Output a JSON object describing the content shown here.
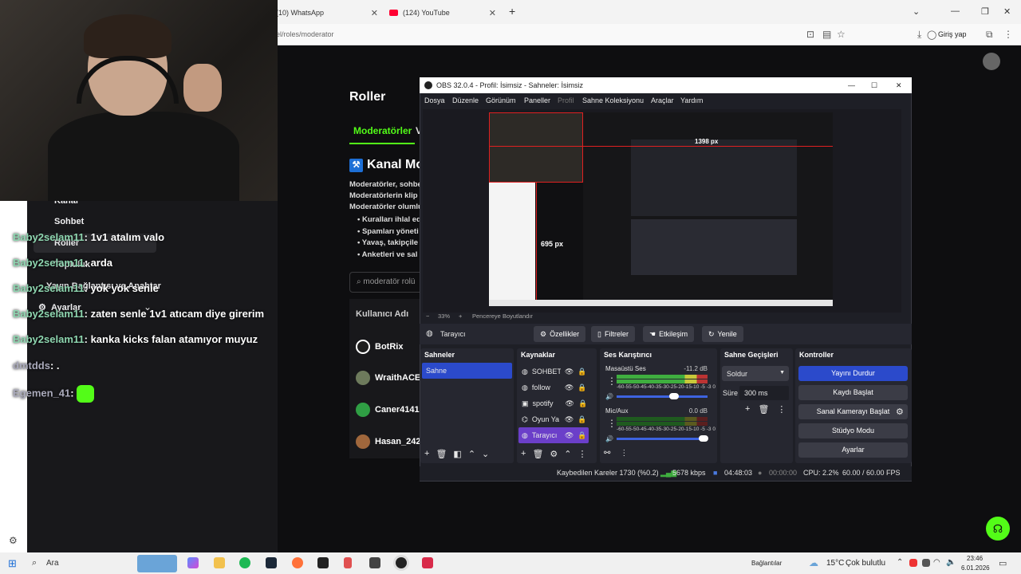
{
  "browser": {
    "tabs": [
      {
        "label": "(10) WhatsApp"
      },
      {
        "label": "(124) YouTube"
      }
    ],
    "url": "el/roles/moderator",
    "login_label": "Giriş yap"
  },
  "chat": {
    "menu": [
      "Kanal",
      "Sohbet",
      "Roller",
      "Topluluk",
      "Yayın Bağlantısı ve Anahtar",
      "Ayarlar"
    ],
    "messages": [
      {
        "user": "Baby2selam11",
        "text": ": 1v1 atalım valo"
      },
      {
        "user": "Baby2selam11",
        "text": ": arda"
      },
      {
        "user": "Baby2selam11",
        "text": ": yok yok senle"
      },
      {
        "user": "Baby2selam11",
        "text": ": zaten senle 1v1 atıcam diye girerim"
      },
      {
        "user": "Baby2selam11",
        "text": ": kanka kicks falan atamıyor muyuz"
      },
      {
        "user": "dmtdds",
        "text": ": ."
      },
      {
        "user": "Egemen_41",
        "text": ":"
      }
    ]
  },
  "kick": {
    "title": "Roller",
    "tab_active": "Moderatörler",
    "tab_next": "V",
    "section_title": "Kanal Mo",
    "desc": [
      "Moderatörler, sohbe",
      "Moderatörlerin klip",
      "Moderatörler olumlu"
    ],
    "bullets": [
      "Kuralları ihlal ed",
      "Spamları yöneti",
      "Yavaş, takipçile",
      "Anketleri ve sal"
    ],
    "search_placeholder": "moderatör rolü",
    "table_header": "Kullanıcı Adı",
    "users": [
      "BotRix",
      "WraithACE",
      "Caner4141",
      "Hasan_242"
    ]
  },
  "obs": {
    "title": "OBS 32.0.4 - Profil: İsimsiz - Sahneler: İsimsiz",
    "menu": [
      "Dosya",
      "Düzenle",
      "Görünüm",
      "Paneller",
      "Profil",
      "Sahne Koleksiyonu",
      "Araçlar",
      "Yardım"
    ],
    "preview_label": "695 px",
    "preview_label_top": "1398 px",
    "zoom": "33%",
    "fit_label": "Pencereye Boyutlandır",
    "source_name": "Tarayıcı",
    "source_buttons": [
      "Özellikler",
      "Filtreler",
      "Etkileşim",
      "Yenile"
    ],
    "docks": {
      "scenes": {
        "title": "Sahneler",
        "items": [
          "Sahne"
        ]
      },
      "sources": {
        "title": "Kaynaklar",
        "items": [
          "SOHBET",
          "follow",
          "spotify",
          "Oyun Ya",
          "Tarayıcı"
        ]
      },
      "mixer": {
        "title": "Ses Karıştırıcı",
        "channels": [
          {
            "name": "Masaüstü Ses",
            "db": "-11.2 dB"
          },
          {
            "name": "Mic/Aux",
            "db": "0.0 dB"
          }
        ],
        "scale": "-60-55-50-45-40-35-30-25-20-15-10 -5 -3 0"
      },
      "transitions": {
        "title": "Sahne Geçişleri",
        "type": "Soldur",
        "duration_label": "Süre",
        "duration": "300 ms"
      },
      "controls": {
        "title": "Kontroller",
        "buttons": [
          "Yayını Durdur",
          "Kaydı Başlat",
          "Sanal Kamerayı Başlat",
          "Stüdyo Modu",
          "Ayarlar"
        ]
      }
    },
    "status": {
      "dropped": "Kaybedilen Kareler 1730 (%0.2)",
      "bitrate": "5678 kbps",
      "stream_time": "04:48:03",
      "rec_time": "00:00:00",
      "cpu": "CPU: 2.2%",
      "fps": "60.00 / 60.00 FPS"
    }
  },
  "taskbar": {
    "search": "Ara",
    "connections": "Bağlantılar",
    "weather_temp": "15°C",
    "weather_desc": "Çok bulutlu",
    "time": "23:46",
    "date": "6.01.2026"
  },
  "colors": {
    "kick_green": "#53fc18",
    "obs_stop": "#2b4acb",
    "obs_active": "#2b4acb",
    "source_selected": "#6b3fc9"
  }
}
